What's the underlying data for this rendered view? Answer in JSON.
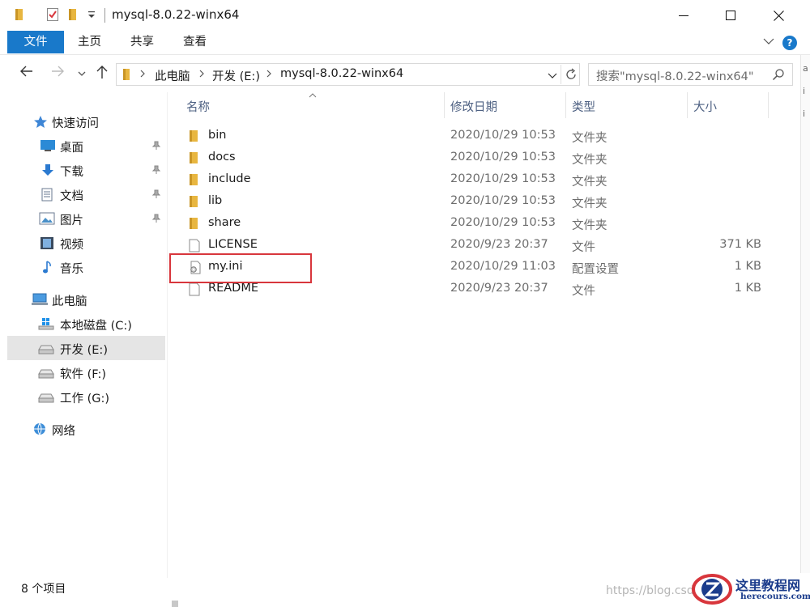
{
  "window": {
    "title": "mysql-8.0.22-winx64",
    "quick_access_toolbar": [
      "folder-icon",
      "properties-checkbox-icon",
      "new-folder-icon",
      "dropdown-arrow-icon"
    ],
    "controls": [
      "minimize-icon",
      "maximize-icon",
      "close-icon"
    ]
  },
  "ribbon": {
    "tabs": [
      {
        "label": "文件",
        "active": true
      },
      {
        "label": "主页"
      },
      {
        "label": "共享"
      },
      {
        "label": "查看"
      }
    ],
    "accent_color": "#1979ca"
  },
  "address": {
    "crumbs": [
      "此电脑",
      "开发 (E:)",
      "mysql-8.0.22-winx64"
    ]
  },
  "search": {
    "placeholder": "搜索\"mysql-8.0.22-winx64\""
  },
  "sidebar": {
    "quick_access": {
      "label": "快速访问"
    },
    "pinned": [
      {
        "label": "桌面",
        "icon": "desktop-icon",
        "pinned": true
      },
      {
        "label": "下载",
        "icon": "download-icon",
        "pinned": true
      },
      {
        "label": "文档",
        "icon": "document-icon",
        "pinned": true
      },
      {
        "label": "图片",
        "icon": "pictures-icon",
        "pinned": true
      },
      {
        "label": "视频",
        "icon": "video-icon",
        "pinned": false
      },
      {
        "label": "音乐",
        "icon": "music-icon",
        "pinned": false
      }
    ],
    "this_pc": {
      "label": "此电脑"
    },
    "drives": [
      {
        "label": "本地磁盘 (C:)",
        "icon": "windows-drive-icon",
        "selected": false
      },
      {
        "label": "开发 (E:)",
        "icon": "drive-icon",
        "selected": true
      },
      {
        "label": "软件 (F:)",
        "icon": "drive-icon",
        "selected": false
      },
      {
        "label": "工作 (G:)",
        "icon": "drive-icon",
        "selected": false
      }
    ],
    "network": {
      "label": "网络"
    }
  },
  "columns": {
    "name": "名称",
    "date": "修改日期",
    "type": "类型",
    "size": "大小"
  },
  "files": [
    {
      "name": "bin",
      "date": "2020/10/29 10:53",
      "type": "文件夹",
      "size": "",
      "icon": "folder-icon"
    },
    {
      "name": "docs",
      "date": "2020/10/29 10:53",
      "type": "文件夹",
      "size": "",
      "icon": "folder-icon"
    },
    {
      "name": "include",
      "date": "2020/10/29 10:53",
      "type": "文件夹",
      "size": "",
      "icon": "folder-icon"
    },
    {
      "name": "lib",
      "date": "2020/10/29 10:53",
      "type": "文件夹",
      "size": "",
      "icon": "folder-icon"
    },
    {
      "name": "share",
      "date": "2020/10/29 10:53",
      "type": "文件夹",
      "size": "",
      "icon": "folder-icon"
    },
    {
      "name": "LICENSE",
      "date": "2020/9/23 20:37",
      "type": "文件",
      "size": "371 KB",
      "icon": "file-icon"
    },
    {
      "name": "my.ini",
      "date": "2020/10/29 11:03",
      "type": "配置设置",
      "size": "1 KB",
      "icon": "config-file-icon",
      "highlighted": true
    },
    {
      "name": "README",
      "date": "2020/9/23 20:37",
      "type": "文件",
      "size": "1 KB",
      "icon": "file-icon"
    }
  ],
  "status": {
    "item_count": "8 个项目"
  },
  "watermark": {
    "url_fragment": "https://blog.csd",
    "logo_cn": "这里教程网",
    "logo_en": "herecours.com"
  },
  "colors": {
    "highlight_box": "#d8363c",
    "folder_yellow": "#e8b640",
    "selected_bg": "#e5e5e5"
  }
}
